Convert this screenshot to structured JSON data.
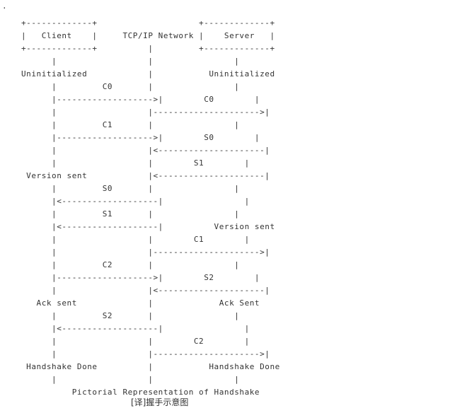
{
  "page": {
    "corner_mark": ".",
    "caption": "[译]握手示意图"
  },
  "diagram": {
    "lines": [
      "+-------------+                    +-------------+",
      "|   Client    |     TCP/IP Network |    Server   |",
      "+-------------+          |         +-------------+",
      "      |                  |                |",
      "Uninitialized            |           Uninitialized",
      "      |         C0       |                |",
      "      |------------------->|        C0        |",
      "      |                  |--------------------->|",
      "      |         C1       |                |",
      "      |------------------->|        S0        |",
      "      |                  |<---------------------|",
      "      |                  |        S1        |",
      " Version sent            |<---------------------|",
      "      |         S0       |                |",
      "      |<-------------------|                |",
      "      |         S1       |                |",
      "      |<-------------------|          Version sent",
      "      |                  |        C1        |",
      "      |                  |--------------------->|",
      "      |         C2       |                |",
      "      |------------------->|        S2        |",
      "      |                  |<---------------------|",
      "   Ack sent              |             Ack Sent",
      "      |         S2       |                |",
      "      |<-------------------|                |",
      "      |                  |        C2        |",
      "      |                  |--------------------->|",
      " Handshake Done          |           Handshake Done",
      "      |                  |                |",
      "          Pictorial Representation of Handshake"
    ]
  }
}
